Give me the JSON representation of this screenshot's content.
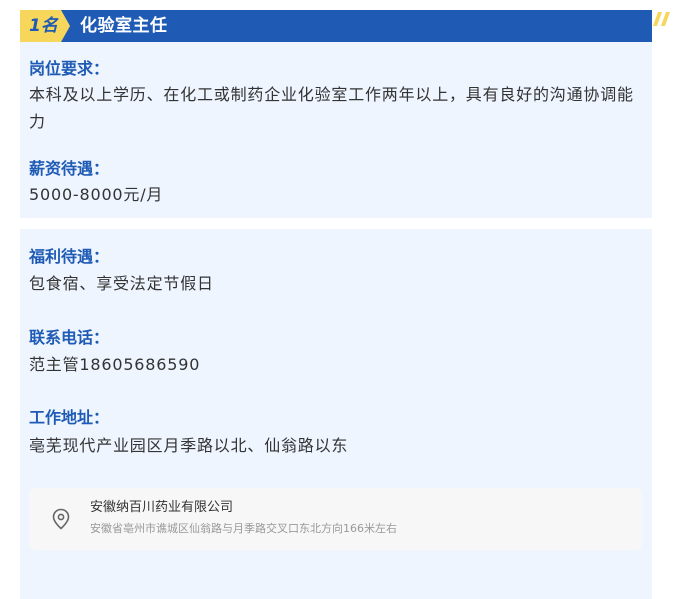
{
  "header": {
    "badge": "1名",
    "title": "化验室主任"
  },
  "colors": {
    "primary_blue": "#1f5bb5",
    "badge_yellow": "#f7d65c",
    "card_background": "#eef5ff"
  },
  "icons": {
    "header_decoration": "double-slash-decoration",
    "location": "map-pin-icon"
  },
  "job": {
    "requirements": {
      "label": "岗位要求：",
      "value": "本科及以上学历、在化工或制药企业化验室工作两年以上，具有良好的沟通协调能力"
    },
    "salary": {
      "label": "薪资待遇：",
      "value": "5000-8000元/月"
    },
    "benefits": {
      "label": "福利待遇：",
      "value": "包食宿、享受法定节假日"
    },
    "phone": {
      "label": "联系电话：",
      "value": "范主管18605686590"
    },
    "address": {
      "label": "工作地址：",
      "value": "亳芜现代产业园区月季路以北、仙翁路以东"
    }
  },
  "location_card": {
    "company": "安徽纳百川药业有限公司",
    "address": "安徽省亳州市谯城区仙翁路与月季路交叉口东北方向166米左右"
  }
}
